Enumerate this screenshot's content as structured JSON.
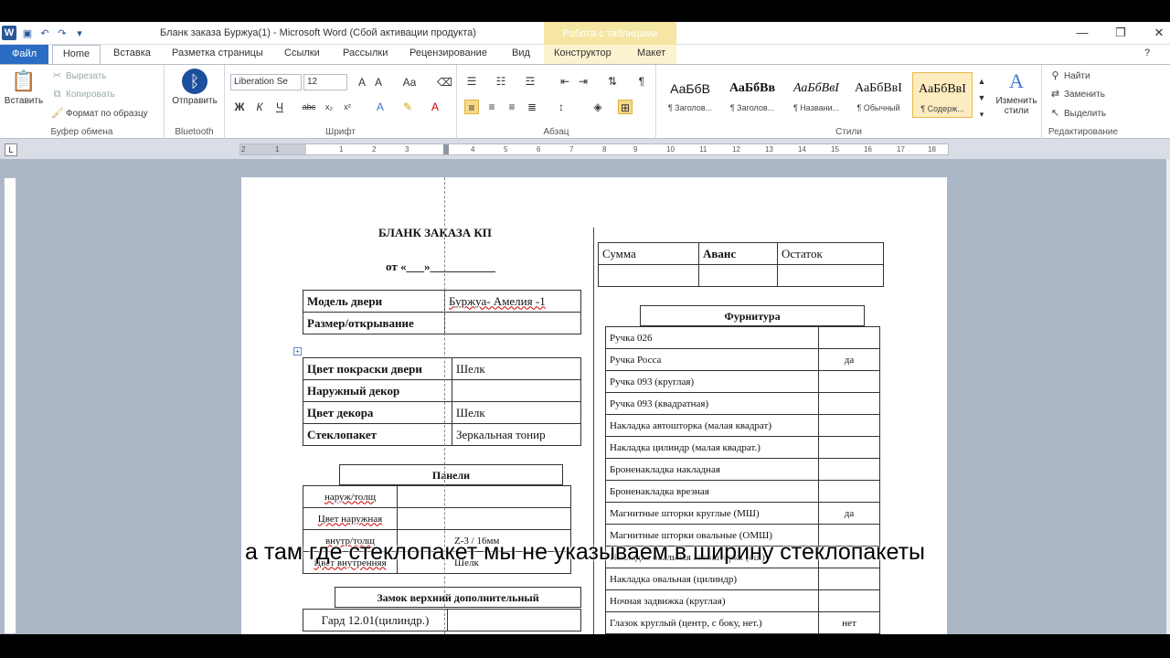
{
  "title_bar": {
    "title": "Бланк заказа Буржуа(1)  -  Microsoft Word (Сбой активации продукта)",
    "context_tab_header": "Работа с таблицами",
    "app_icon": "W"
  },
  "tabs": [
    "Файл",
    "Home",
    "Вставка",
    "Разметка страницы",
    "Ссылки",
    "Рассылки",
    "Рецензирование",
    "Вид",
    "Конструктор",
    "Макет"
  ],
  "ribbon": {
    "clipboard": {
      "paste": "Вставить",
      "cut": "Вырезать",
      "copy": "Копировать",
      "format_painter": "Формат по образцу",
      "label": "Буфер обмена"
    },
    "bluetooth": {
      "send": "Отправить",
      "label": "Bluetooth"
    },
    "font": {
      "name": "Liberation Se",
      "size": "12",
      "label": "Шрифт"
    },
    "paragraph": {
      "label": "Абзац"
    },
    "styles": {
      "items": [
        {
          "sample": "АаБбВ",
          "name": "¶ Заголов..."
        },
        {
          "sample": "АаБбВв",
          "name": "¶ Заголов..."
        },
        {
          "sample": "АаБбВвI",
          "name": "¶ Названи..."
        },
        {
          "sample": "АаБбВвI",
          "name": "¶ Обычный"
        },
        {
          "sample": "АаБбВвI",
          "name": "¶ Содерж..."
        }
      ],
      "change": "Изменить стили",
      "label": "Стили"
    },
    "editing": {
      "find": "Найти",
      "replace": "Заменить",
      "select": "Выделить",
      "label": "Редактирование"
    }
  },
  "ruler": [
    "2",
    "1",
    "1",
    "2",
    "3",
    "4",
    "5",
    "6",
    "7",
    "8",
    "9",
    "10",
    "11",
    "12",
    "13",
    "14",
    "15",
    "16",
    "17",
    "18",
    "19"
  ],
  "document": {
    "title": "БЛАНК ЗАКАЗА КП",
    "date_line": "от «___»___________",
    "model_table": [
      [
        "Модель двери",
        "Буржуа- Амелия -1"
      ],
      [
        "Размер/открывание",
        ""
      ]
    ],
    "color_table": [
      [
        "Цвет покраски двери",
        "Шелк"
      ],
      [
        "Наружный декор",
        ""
      ],
      [
        "Цвет декора",
        "Шелк"
      ],
      [
        "Стеклопакет",
        "Зеркальная тонир"
      ]
    ],
    "panels_title": "Панели",
    "panels_table": [
      [
        "наруж/толщ",
        ""
      ],
      [
        "Цвет наружная",
        ""
      ],
      [
        "внутр/толщ",
        "Z-3 / 16мм"
      ],
      [
        "Цвет внутренняя",
        "Шелк"
      ]
    ],
    "lock_title": "Замок верхний дополнительный",
    "lock_table": [
      [
        "Гард 12.01(цилиндр.)",
        ""
      ]
    ],
    "payment_table": {
      "headers": [
        "Сумма",
        "Аванс",
        "Остаток"
      ],
      "row": [
        "",
        "",
        ""
      ]
    },
    "hardware_title": "Фурнитура",
    "hardware_table": [
      [
        "Ручка 026",
        ""
      ],
      [
        "Ручка Росса",
        "да"
      ],
      [
        "Ручка 093 (круглая)",
        ""
      ],
      [
        "Ручка 093 (квадратная)",
        ""
      ],
      [
        "Накладка автошторка (малая квадрат)",
        ""
      ],
      [
        "Накладка цилиндр (малая квадрат.)",
        ""
      ],
      [
        "Броненакладка накладная",
        ""
      ],
      [
        "Броненакладка врезная",
        ""
      ],
      [
        "Магнитные шторки круглые (МШ)",
        "да"
      ],
      [
        "Магнитные шторки овальные (ОМШ)",
        ""
      ],
      [
        "Накладка овальная автошторка (ош)",
        ""
      ],
      [
        "Накладка овальная (цилиндр)",
        ""
      ],
      [
        "Ночная задвижка (круглая)",
        ""
      ],
      [
        "Глазок круглый (центр, с боку, нет.)",
        "нет"
      ]
    ]
  },
  "subtitle": "а там где стеклопакет мы не указываем в ширину стеклопакеты"
}
